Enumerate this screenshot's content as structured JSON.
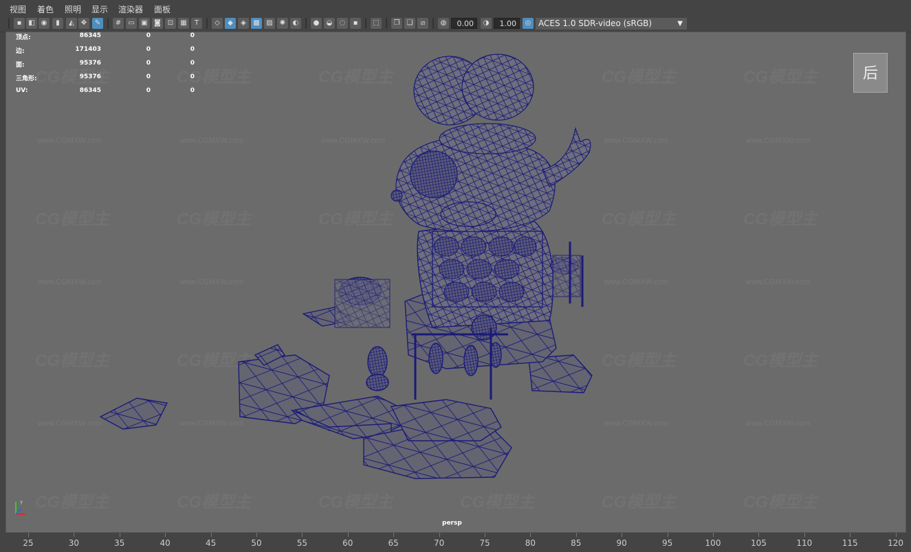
{
  "menu": [
    "视图",
    "着色",
    "照明",
    "显示",
    "渲染器",
    "面板"
  ],
  "toolbar": {
    "exposure": "0.00",
    "gamma": "1.00",
    "colorspace": "ACES 1.0 SDR-video (sRGB)"
  },
  "hud": [
    {
      "label": "顶点:",
      "v1": "86345",
      "v2": "0",
      "v3": "0"
    },
    {
      "label": "边:",
      "v1": "171403",
      "v2": "0",
      "v3": "0"
    },
    {
      "label": "面:",
      "v1": "95376",
      "v2": "0",
      "v3": "0"
    },
    {
      "label": "三角形:",
      "v1": "95376",
      "v2": "0",
      "v3": "0"
    },
    {
      "label": "UV:",
      "v1": "86345",
      "v2": "0",
      "v3": "0"
    }
  ],
  "viewcube_label": "后",
  "camera": "persp",
  "watermark": {
    "logo": "CG模型主",
    "url": "www.CGMXW.com"
  },
  "ruler": [
    "25",
    "30",
    "35",
    "40",
    "45",
    "50",
    "55",
    "60",
    "65",
    "70",
    "75",
    "80",
    "85",
    "90",
    "95",
    "100",
    "105",
    "110",
    "115",
    "120"
  ],
  "colors": {
    "wire": "#1a1a78",
    "mesh_fill": "#6e6e7c",
    "viewport_bg": "#6b6b6b"
  }
}
